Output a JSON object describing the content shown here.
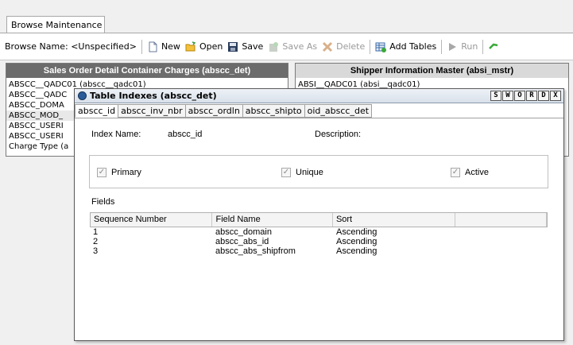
{
  "doc_tab": {
    "label": "Browse Maintenance",
    "close": "✕"
  },
  "toolbar": {
    "browse_name": "Browse Name: <Unspecified>",
    "new": "New",
    "open": "Open",
    "save": "Save",
    "save_as": "Save As",
    "delete": "Delete",
    "add_tables": "Add Tables",
    "run": "Run"
  },
  "left_table": {
    "title": "Sales Order Detail Container Charges (abscc_det)",
    "rows": [
      "ABSCC__QADC01 (abscc__qadc01)",
      "ABSCC__QADC",
      "ABSCC_DOMA",
      "ABSCC_MOD_",
      "ABSCC_USERI",
      "ABSCC_USERI",
      "Charge Type (a"
    ]
  },
  "right_table": {
    "title": "Shipper Information Master (absi_mstr)",
    "rows": [
      "ABSI__QADC01 (absi__qadc01)"
    ]
  },
  "dialog": {
    "title": "Table Indexes (abscc_det)",
    "window_buttons": [
      "S",
      "W",
      "O",
      "R",
      "D",
      "X"
    ],
    "tabs": [
      "abscc_id",
      "abscc_inv_nbr",
      "abscc_ordln",
      "abscc_shipto",
      "oid_abscc_det"
    ],
    "index_name_label": "Index Name:",
    "index_name_value": "abscc_id",
    "description_label": "Description:",
    "flags": [
      {
        "label": "Primary",
        "checked": true
      },
      {
        "label": "Unique",
        "checked": true
      },
      {
        "label": "Active",
        "checked": true
      }
    ],
    "fields_label": "Fields",
    "columns": [
      "Sequence Number",
      "Field Name",
      "Sort",
      ""
    ],
    "rows": [
      [
        "1",
        "abscc_domain",
        "Ascending"
      ],
      [
        "2",
        "abscc_abs_id",
        "Ascending"
      ],
      [
        "3",
        "abscc_abs_shipfrom",
        "Ascending"
      ]
    ]
  }
}
